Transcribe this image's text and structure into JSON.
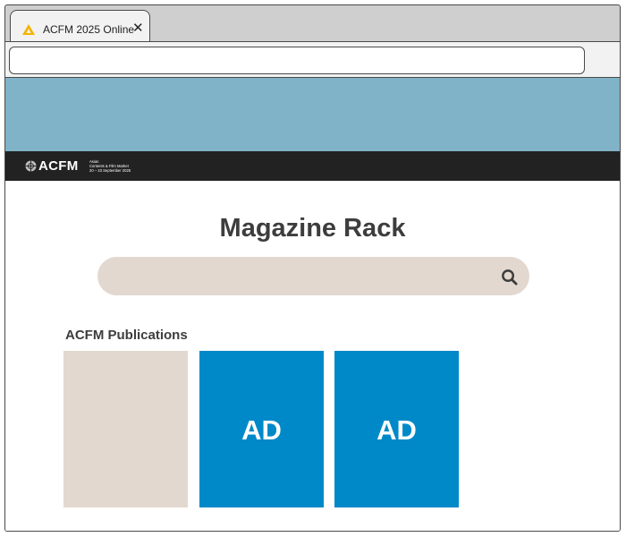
{
  "browser": {
    "tab": {
      "title": "ACFM 2025 Online",
      "close_glyph": "✕",
      "logo_icon": "acfm-triangle-logo-icon"
    },
    "address_bar": {
      "value": ""
    }
  },
  "brand": {
    "name": "ACFM",
    "subtitle_lines": [
      "Asian",
      "Contents & Film Market",
      "20 – 23 September 2025"
    ]
  },
  "page": {
    "title": "Magazine Rack",
    "search": {
      "placeholder": "",
      "icon": "search-icon"
    },
    "section_heading": "ACFM Publications",
    "publications": [
      {
        "label": ""
      },
      {
        "label": "AD"
      },
      {
        "label": "AD"
      }
    ]
  },
  "colors": {
    "hero": "#80b3c8",
    "brand_bar": "#222222",
    "search_bg": "#e2d8cf",
    "ad_blue": "#0089c8",
    "tab_logo": "#f5b400"
  }
}
